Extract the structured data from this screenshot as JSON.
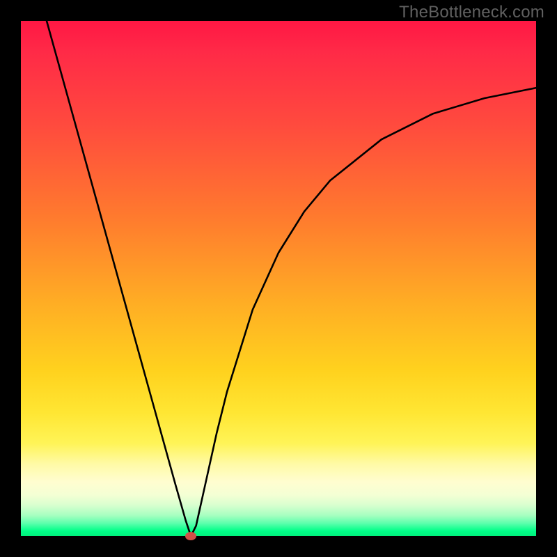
{
  "watermark": "TheBottleneck.com",
  "chart_data": {
    "type": "line",
    "title": "",
    "xlabel": "",
    "ylabel": "",
    "xlim": [
      0,
      100
    ],
    "ylim": [
      0,
      100
    ],
    "grid": false,
    "legend": false,
    "annotation_marker": {
      "x": 33,
      "y": 0,
      "color": "#d15048"
    },
    "background_gradient": "red-top-to-green-bottom",
    "series": [
      {
        "name": "left-branch",
        "x": [
          5,
          10,
          15,
          20,
          25,
          30,
          32,
          33
        ],
        "y": [
          100,
          82,
          64,
          46,
          28,
          10,
          3,
          0
        ]
      },
      {
        "name": "right-branch",
        "x": [
          34,
          36,
          38,
          40,
          45,
          50,
          55,
          60,
          70,
          80,
          90,
          100
        ],
        "y": [
          2,
          11,
          20,
          28,
          44,
          55,
          63,
          69,
          77,
          82,
          85,
          87
        ]
      }
    ]
  },
  "colors": {
    "curve": "#000000",
    "marker": "#d15048",
    "frame": "#000000"
  }
}
